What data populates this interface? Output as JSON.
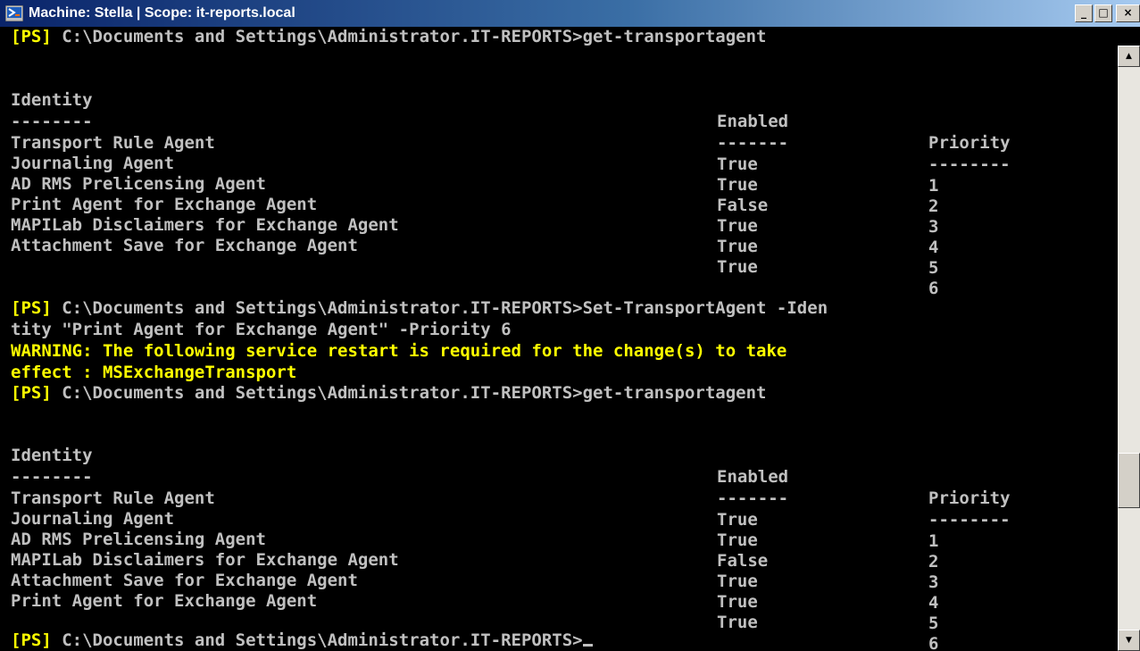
{
  "window": {
    "title": "Machine: Stella | Scope: it-reports.local",
    "controls": {
      "minimize_icon": "_",
      "maximize_icon": "□",
      "close_icon": "×"
    }
  },
  "console": {
    "prompt_tag": "[PS]",
    "prompt_path": " C:\\Documents and Settings\\Administrator.IT-REPORTS>",
    "command1": "get-transportagent",
    "table1": {
      "headers": {
        "identity": "Identity",
        "enabled": "Enabled",
        "priority": "Priority"
      },
      "underlines": {
        "identity": "--------",
        "enabled": "-------",
        "priority": "--------"
      },
      "rows": [
        {
          "identity": "Transport Rule Agent",
          "enabled": "True",
          "priority": "1"
        },
        {
          "identity": "Journaling Agent",
          "enabled": "True",
          "priority": "2"
        },
        {
          "identity": "AD RMS Prelicensing Agent",
          "enabled": "False",
          "priority": "3"
        },
        {
          "identity": "Print Agent for Exchange Agent",
          "enabled": "True",
          "priority": "4"
        },
        {
          "identity": "MAPILab Disclaimers for Exchange Agent",
          "enabled": "True",
          "priority": "5"
        },
        {
          "identity": "Attachment Save for Exchange Agent",
          "enabled": "True",
          "priority": "6"
        }
      ]
    },
    "command2_line1": "Set-TransportAgent -Iden",
    "command2_line2": "tity \"Print Agent for Exchange Agent\" -Priority 6",
    "warning_line1": "WARNING: The following service restart is required for the change(s) to take",
    "warning_line2": "effect : MSExchangeTransport",
    "command3": "get-transportagent",
    "table2": {
      "headers": {
        "identity": "Identity",
        "enabled": "Enabled",
        "priority": "Priority"
      },
      "underlines": {
        "identity": "--------",
        "enabled": "-------",
        "priority": "--------"
      },
      "rows": [
        {
          "identity": "Transport Rule Agent",
          "enabled": "True",
          "priority": "1"
        },
        {
          "identity": "Journaling Agent",
          "enabled": "True",
          "priority": "2"
        },
        {
          "identity": "AD RMS Prelicensing Agent",
          "enabled": "False",
          "priority": "3"
        },
        {
          "identity": "MAPILab Disclaimers for Exchange Agent",
          "enabled": "True",
          "priority": "4"
        },
        {
          "identity": "Attachment Save for Exchange Agent",
          "enabled": "True",
          "priority": "5"
        },
        {
          "identity": "Print Agent for Exchange Agent",
          "enabled": "True",
          "priority": "6"
        }
      ]
    }
  },
  "scrollbar": {
    "up_icon": "▲",
    "down_icon": "▼"
  },
  "colors": {
    "console_bg": "#000000",
    "console_text": "#c0c0c0",
    "highlight": "#ffff00",
    "titlebar": "#0a246a"
  }
}
